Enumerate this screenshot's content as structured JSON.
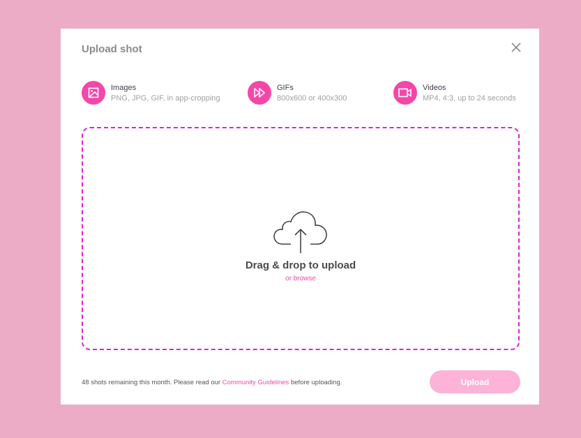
{
  "modal": {
    "title": "Upload shot"
  },
  "types": [
    {
      "name": "Images",
      "desc": "PNG, JPG, GIF, in app-cropping",
      "icon": "image-icon"
    },
    {
      "name": "GIFs",
      "desc": "800x600 or 400x300",
      "icon": "fast-forward-icon"
    },
    {
      "name": "Videos",
      "desc": "MP4, 4:3, up to 24 seconds",
      "icon": "video-camera-icon"
    }
  ],
  "dropzone": {
    "title": "Drag & drop to upload",
    "browse": "or browse"
  },
  "footer": {
    "prefix": "48 shots remaining this month. Please read our ",
    "link": "Community Guidelines",
    "suffix": " before uploading.",
    "upload": "Upload"
  },
  "colors": {
    "accent": "#f546a9",
    "dash": "#e619e6",
    "background": "#ecacc6",
    "button": "#fdb3d8"
  }
}
